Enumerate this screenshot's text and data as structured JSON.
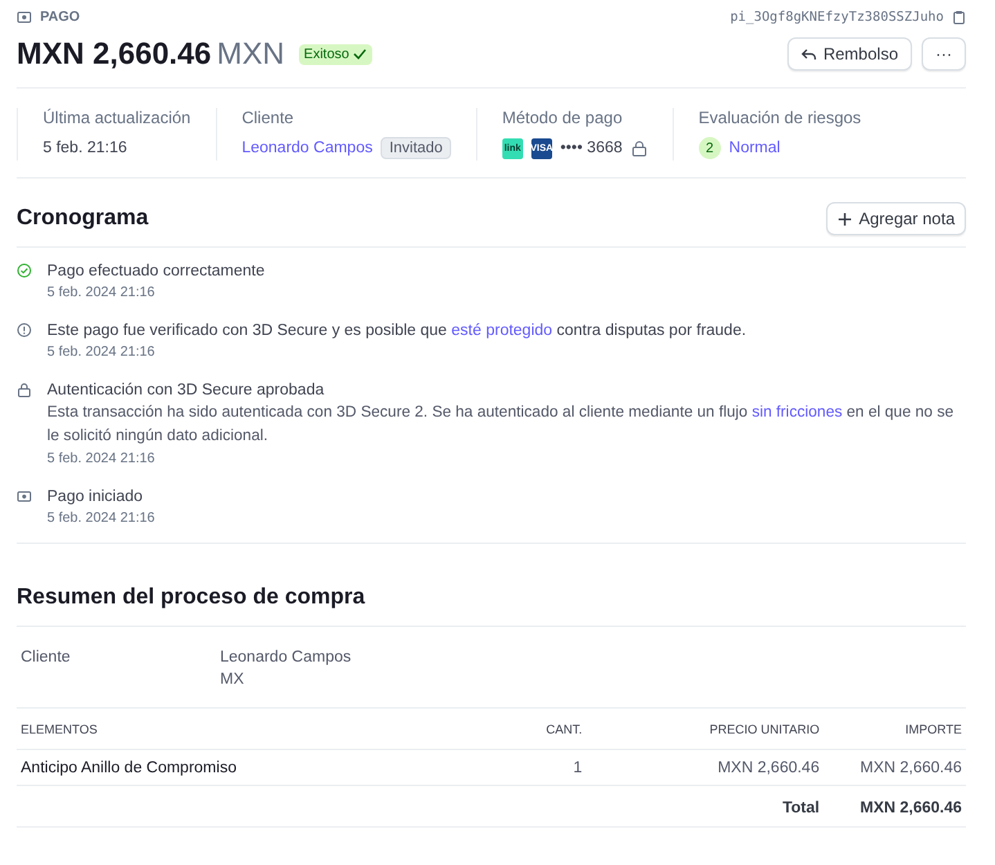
{
  "header": {
    "section": "PAGO",
    "payment_id": "pi_3Ogf8gKNEfzyTz380SSZJuho",
    "amount": "MXN 2,660.46",
    "currency": "MXN",
    "status": "Exitoso",
    "status_ok": true,
    "refund_button": "Rembolso",
    "more_button": "···"
  },
  "details": [
    {
      "kind": "text",
      "label": "Última actualización",
      "value": "5 feb. 21:16"
    },
    {
      "kind": "customer",
      "label": "Cliente",
      "value": "Leonardo Campos",
      "badge": "Invitado"
    },
    {
      "kind": "card",
      "label": "Método de pago",
      "brands": [
        {
          "text": "link",
          "color": "#33ddb3"
        },
        {
          "text": "VISA",
          "color": "#1a4a8f"
        }
      ],
      "value": "•••• 3668"
    },
    {
      "kind": "risk",
      "label": "Evaluación de riesgos",
      "score": "2",
      "value": "Normal"
    }
  ],
  "timeline": {
    "title": "Cronograma",
    "add_note_button": "Agregar nota",
    "events": [
      {
        "kind": "success",
        "title": [
          {
            "text": "Pago efectuado correctamente",
            "link": false
          }
        ],
        "time": "5 feb. 2024 21:16"
      },
      {
        "kind": "info",
        "title": [
          {
            "text": "Este pago fue verificado con 3D Secure y es posible que ",
            "link": false
          },
          {
            "text": "esté protegido",
            "link": true
          },
          {
            "text": " contra disputas por fraude.",
            "link": false
          }
        ],
        "time": "5 feb. 2024 21:16"
      },
      {
        "kind": "lock",
        "title": [
          {
            "text": "Autenticación con 3D Secure aprobada",
            "link": false
          }
        ],
        "body": [
          {
            "text": "Esta transacción ha sido autenticada con 3D Secure 2. Se ha autenticado al cliente mediante un flujo ",
            "link": false
          },
          {
            "text": "sin fricciones",
            "link": true
          },
          {
            "text": " en el que no se le solicitó ningún dato adicional.",
            "link": false
          }
        ],
        "time": "5 feb. 2024 21:16"
      },
      {
        "kind": "card",
        "title": [
          {
            "text": "Pago iniciado",
            "link": false
          }
        ],
        "time": "5 feb. 2024 21:16"
      }
    ]
  },
  "checkout": {
    "title": "Resumen del proceso de compra",
    "customer_label": "Cliente",
    "customer_name": "Leonardo Campos",
    "customer_country": "MX",
    "columns": [
      "ELEMENTOS",
      "CANT.",
      "PRECIO UNITARIO",
      "IMPORTE"
    ],
    "rows": [
      [
        "Anticipo Anillo de Compromiso",
        "1",
        "MXN 2,660.46",
        "MXN 2,660.46"
      ]
    ],
    "total_label": "Total",
    "total": "MXN 2,660.46"
  }
}
